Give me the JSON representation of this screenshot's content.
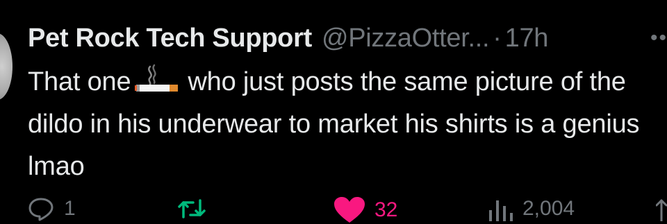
{
  "tweet": {
    "display_name": "Pet Rock Tech Support",
    "handle": "@PizzaOtter...",
    "separator": "·",
    "time": "17h",
    "more_icon": "more-dots-icon",
    "text_before_emoji": "That one",
    "emoji": "cigarette-emoji",
    "text_after_emoji": "who just posts the same picture of the dildo in his underwear to market his shirts is a genius lmao"
  },
  "actions": {
    "reply": {
      "icon": "reply-icon",
      "count": "1"
    },
    "retweet": {
      "icon": "retweet-icon",
      "count": ""
    },
    "like": {
      "icon": "heart-icon",
      "count": "32",
      "color": "#f91880"
    },
    "views": {
      "icon": "views-icon",
      "count": "2,004"
    },
    "share": {
      "icon": "share-icon"
    }
  },
  "colors": {
    "background": "#000000",
    "primary_text": "#e7e9ea",
    "secondary_text": "#71767b",
    "retweet_accent": "#00ba7c",
    "like_accent": "#f91880"
  }
}
